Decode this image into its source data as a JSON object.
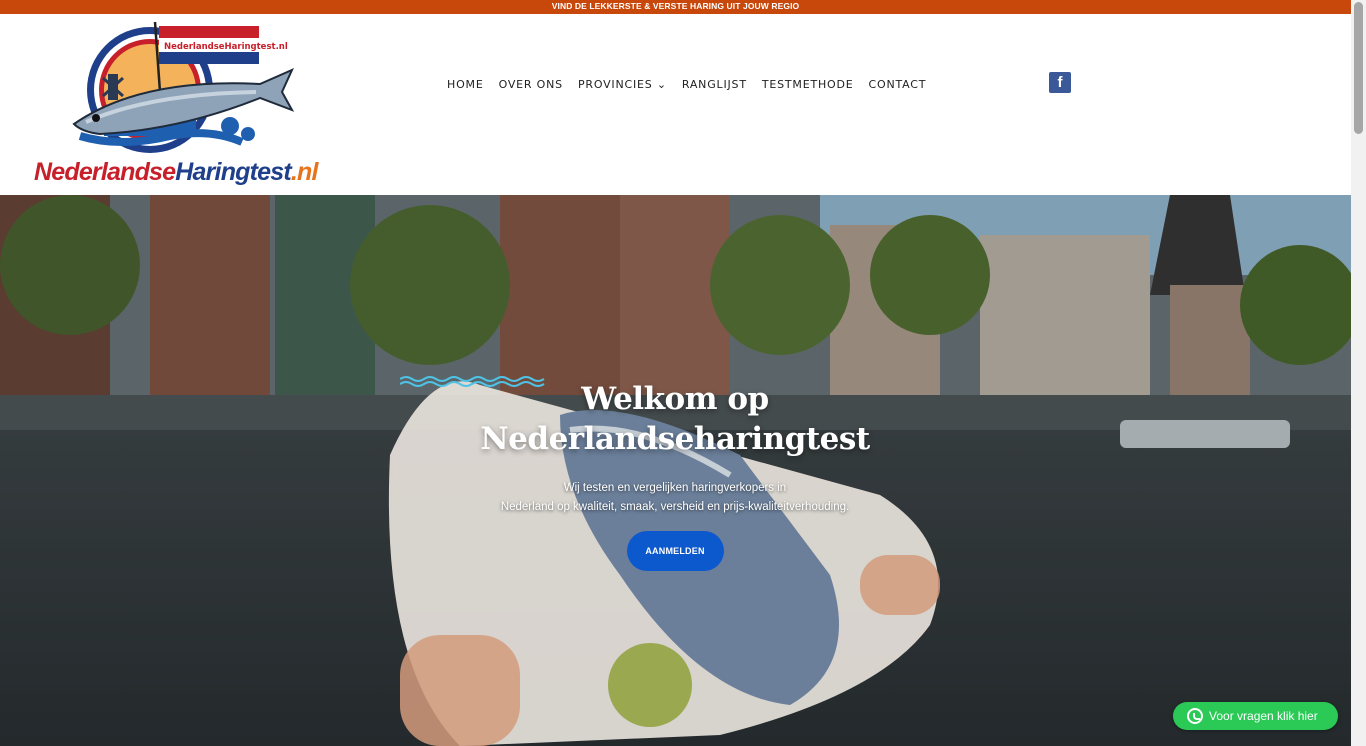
{
  "topbar": {
    "text": "VIND DE LEKKERSTE & VERSTE HARING UIT JOUW REGIO"
  },
  "header": {
    "logo": {
      "flag_text": "NederlandseHaringtest.nl",
      "part1": "Nederlandse",
      "part2": "Haringtest",
      "part3": ".nl"
    },
    "nav": [
      {
        "label": "HOME"
      },
      {
        "label": "OVER ONS"
      },
      {
        "label": "PROVINCIES ⌄"
      },
      {
        "label": "RANGLIJST"
      },
      {
        "label": "TESTMETHODE"
      },
      {
        "label": "CONTACT"
      }
    ],
    "social": {
      "facebook_glyph": "f",
      "icon": "facebook-icon"
    }
  },
  "hero": {
    "title_line1": "Welkom op",
    "title_line2": "Nederlandseharingtest",
    "sub_line1": "Wij testen en vergelijken haringverkopers in",
    "sub_line2": "Nederland op kwaliteit, smaak, versheid en prijs-kwaliteitverhouding.",
    "cta": "AANMELDEN"
  },
  "whatsapp": {
    "label": "Voor vragen klik hier",
    "icon": "whatsapp-icon"
  },
  "colors": {
    "topbar": "#c8480b",
    "cta": "#0c58cd",
    "whatsapp": "#2bc956",
    "facebook": "#3b5998",
    "wave": "#4fc3e6"
  }
}
